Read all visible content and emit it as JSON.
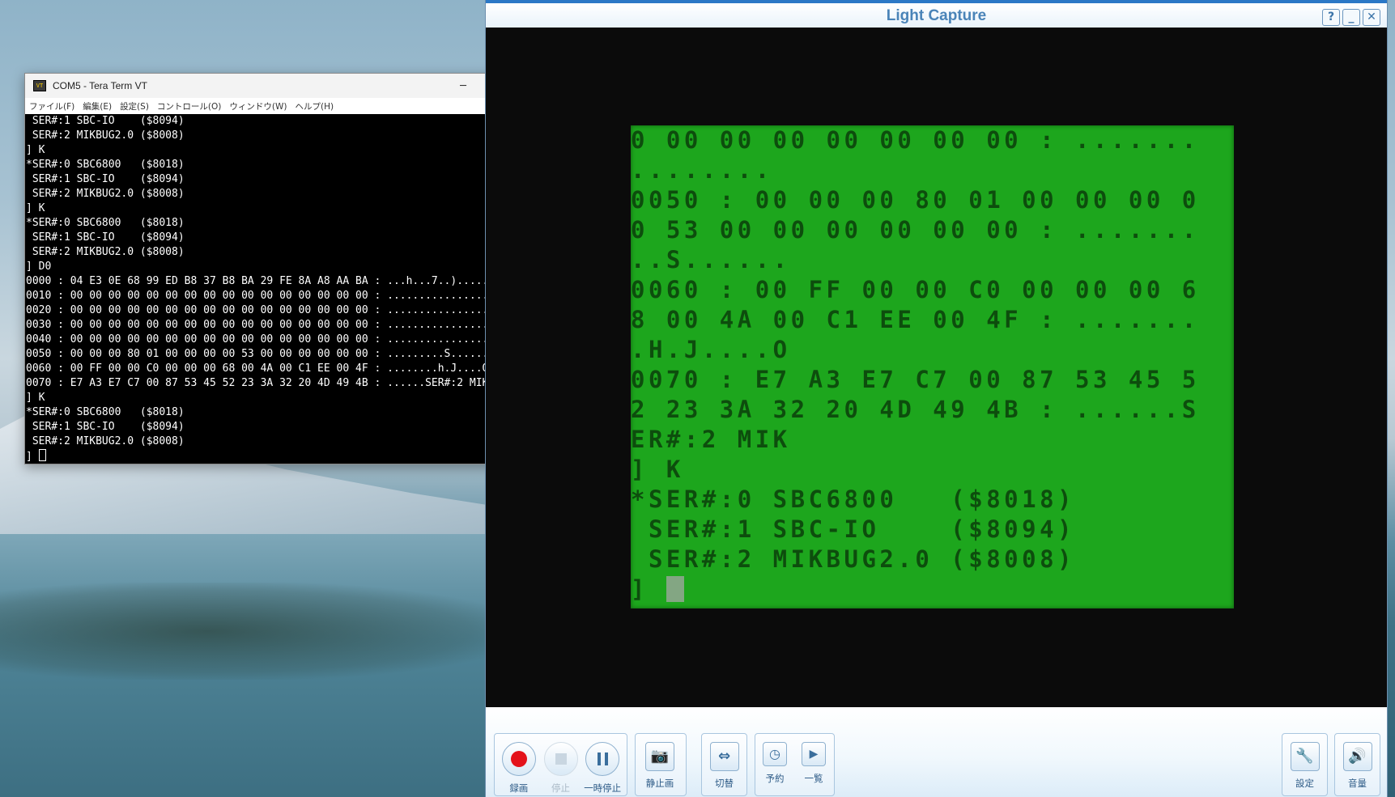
{
  "teraterm": {
    "title": "COM5 - Tera Term VT",
    "app_icon_text": "VT",
    "window_controls": [
      "─",
      "☐",
      "✕"
    ],
    "menu": [
      "ファイル(F)",
      "編集(E)",
      "設定(S)",
      "コントロール(O)",
      "ウィンドウ(W)",
      "ヘルプ(H)"
    ],
    "lines": [
      " SER#:1 SBC-IO    ($8094)",
      " SER#:2 MIKBUG2.0 ($8008)",
      "] K",
      "*SER#:0 SBC6800   ($8018)",
      " SER#:1 SBC-IO    ($8094)",
      " SER#:2 MIKBUG2.0 ($8008)",
      "] K",
      "*SER#:0 SBC6800   ($8018)",
      " SER#:1 SBC-IO    ($8094)",
      " SER#:2 MIKBUG2.0 ($8008)",
      "] D0",
      "0000 : 04 E3 0E 68 99 ED B8 37 B8 BA 29 FE 8A A8 AA BA : ...h...7..).....",
      "0010 : 00 00 00 00 00 00 00 00 00 00 00 00 00 00 00 00 : ................",
      "0020 : 00 00 00 00 00 00 00 00 00 00 00 00 00 00 00 00 : ................",
      "0030 : 00 00 00 00 00 00 00 00 00 00 00 00 00 00 00 00 : ................",
      "0040 : 00 00 00 00 00 00 00 00 00 00 00 00 00 00 00 00 : ................",
      "0050 : 00 00 00 80 01 00 00 00 00 53 00 00 00 00 00 00 : .........S......",
      "0060 : 00 FF 00 00 C0 00 00 00 68 00 4A 00 C1 EE 00 4F : ........h.J....O",
      "0070 : E7 A3 E7 C7 00 87 53 45 52 23 3A 32 20 4D 49 4B : ......SER#:2 MIK",
      "] K",
      "*SER#:0 SBC6800   ($8018)",
      " SER#:1 SBC-IO    ($8094)",
      " SER#:2 MIKBUG2.0 ($8008)"
    ],
    "prompt": "] "
  },
  "lightcapture": {
    "title": "Light Capture",
    "title_buttons": [
      "?",
      "_",
      "✕"
    ],
    "screen_lines": [
      "0 00 00 00 00 00 00 00 : .......",
      "........",
      "0050 : 00 00 00 80 01 00 00 00 0",
      "0 53 00 00 00 00 00 00 : .......",
      "..S......",
      "0060 : 00 FF 00 00 C0 00 00 00 6",
      "8 00 4A 00 C1 EE 00 4F : .......",
      ".H.J....O",
      "0070 : E7 A3 E7 C7 00 87 53 45 5",
      "2 23 3A 32 20 4D 49 4B : ......S",
      "ER#:2 MIK",
      "] K",
      "*SER#:0 SBC6800   ($8018)",
      " SER#:1 SBC-IO    ($8094)",
      " SER#:2 MIKBUG2.0 ($8008)"
    ],
    "screen_prompt": "] ",
    "toolbar": {
      "record": "録画",
      "stop": "停止",
      "pause": "一時停止",
      "snapshot": "静止画",
      "switch": "切替",
      "schedule": "予約",
      "list": "一覧",
      "settings": "設定",
      "volume": "音量"
    },
    "icons": {
      "record": "record-icon",
      "stop": "stop-icon",
      "pause": "pause-icon",
      "snapshot": "camera-icon",
      "switch": "swap-arrows-icon",
      "schedule": "clock-icon",
      "list": "play-list-icon",
      "settings": "wrench-icon",
      "volume": "speaker-icon"
    },
    "colors": {
      "screen_green": "#1da61d",
      "record_red": "#e4121a",
      "title_blue": "#4a84b8"
    }
  }
}
